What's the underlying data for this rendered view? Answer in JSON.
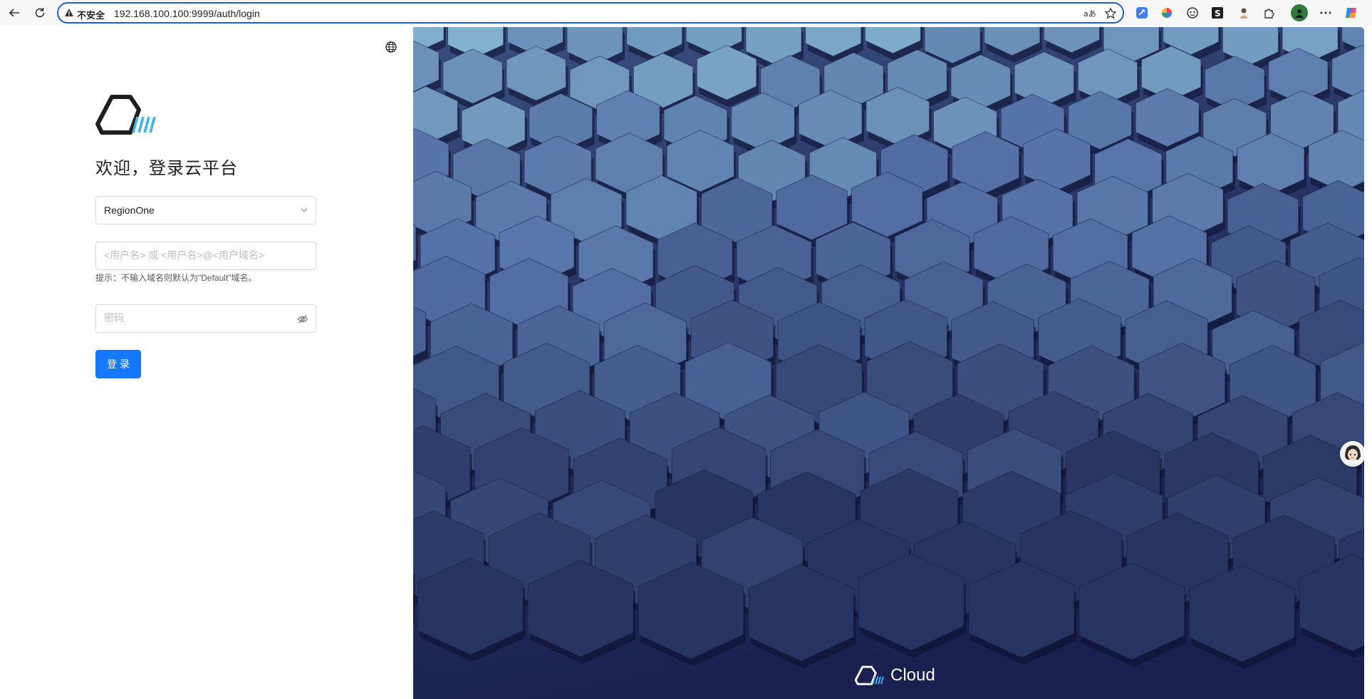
{
  "browser": {
    "security_label": "不安全",
    "url": "192.168.100.100:9999/auth/login"
  },
  "login": {
    "title": "欢迎，登录云平台",
    "region_value": "RegionOne",
    "username_placeholder": "<用户名> 或 <用户名>@<用户域名>",
    "hint": "提示：不输入域名则默认为\"Default\"域名。",
    "password_placeholder": "密码",
    "submit_label": "登录"
  },
  "brand": {
    "name": "Cloud"
  },
  "colors": {
    "primary": "#1677ff",
    "background_dark": "#1e2754",
    "hex_light": "#8fc4dc",
    "logo_accent": "#3db4f2"
  }
}
